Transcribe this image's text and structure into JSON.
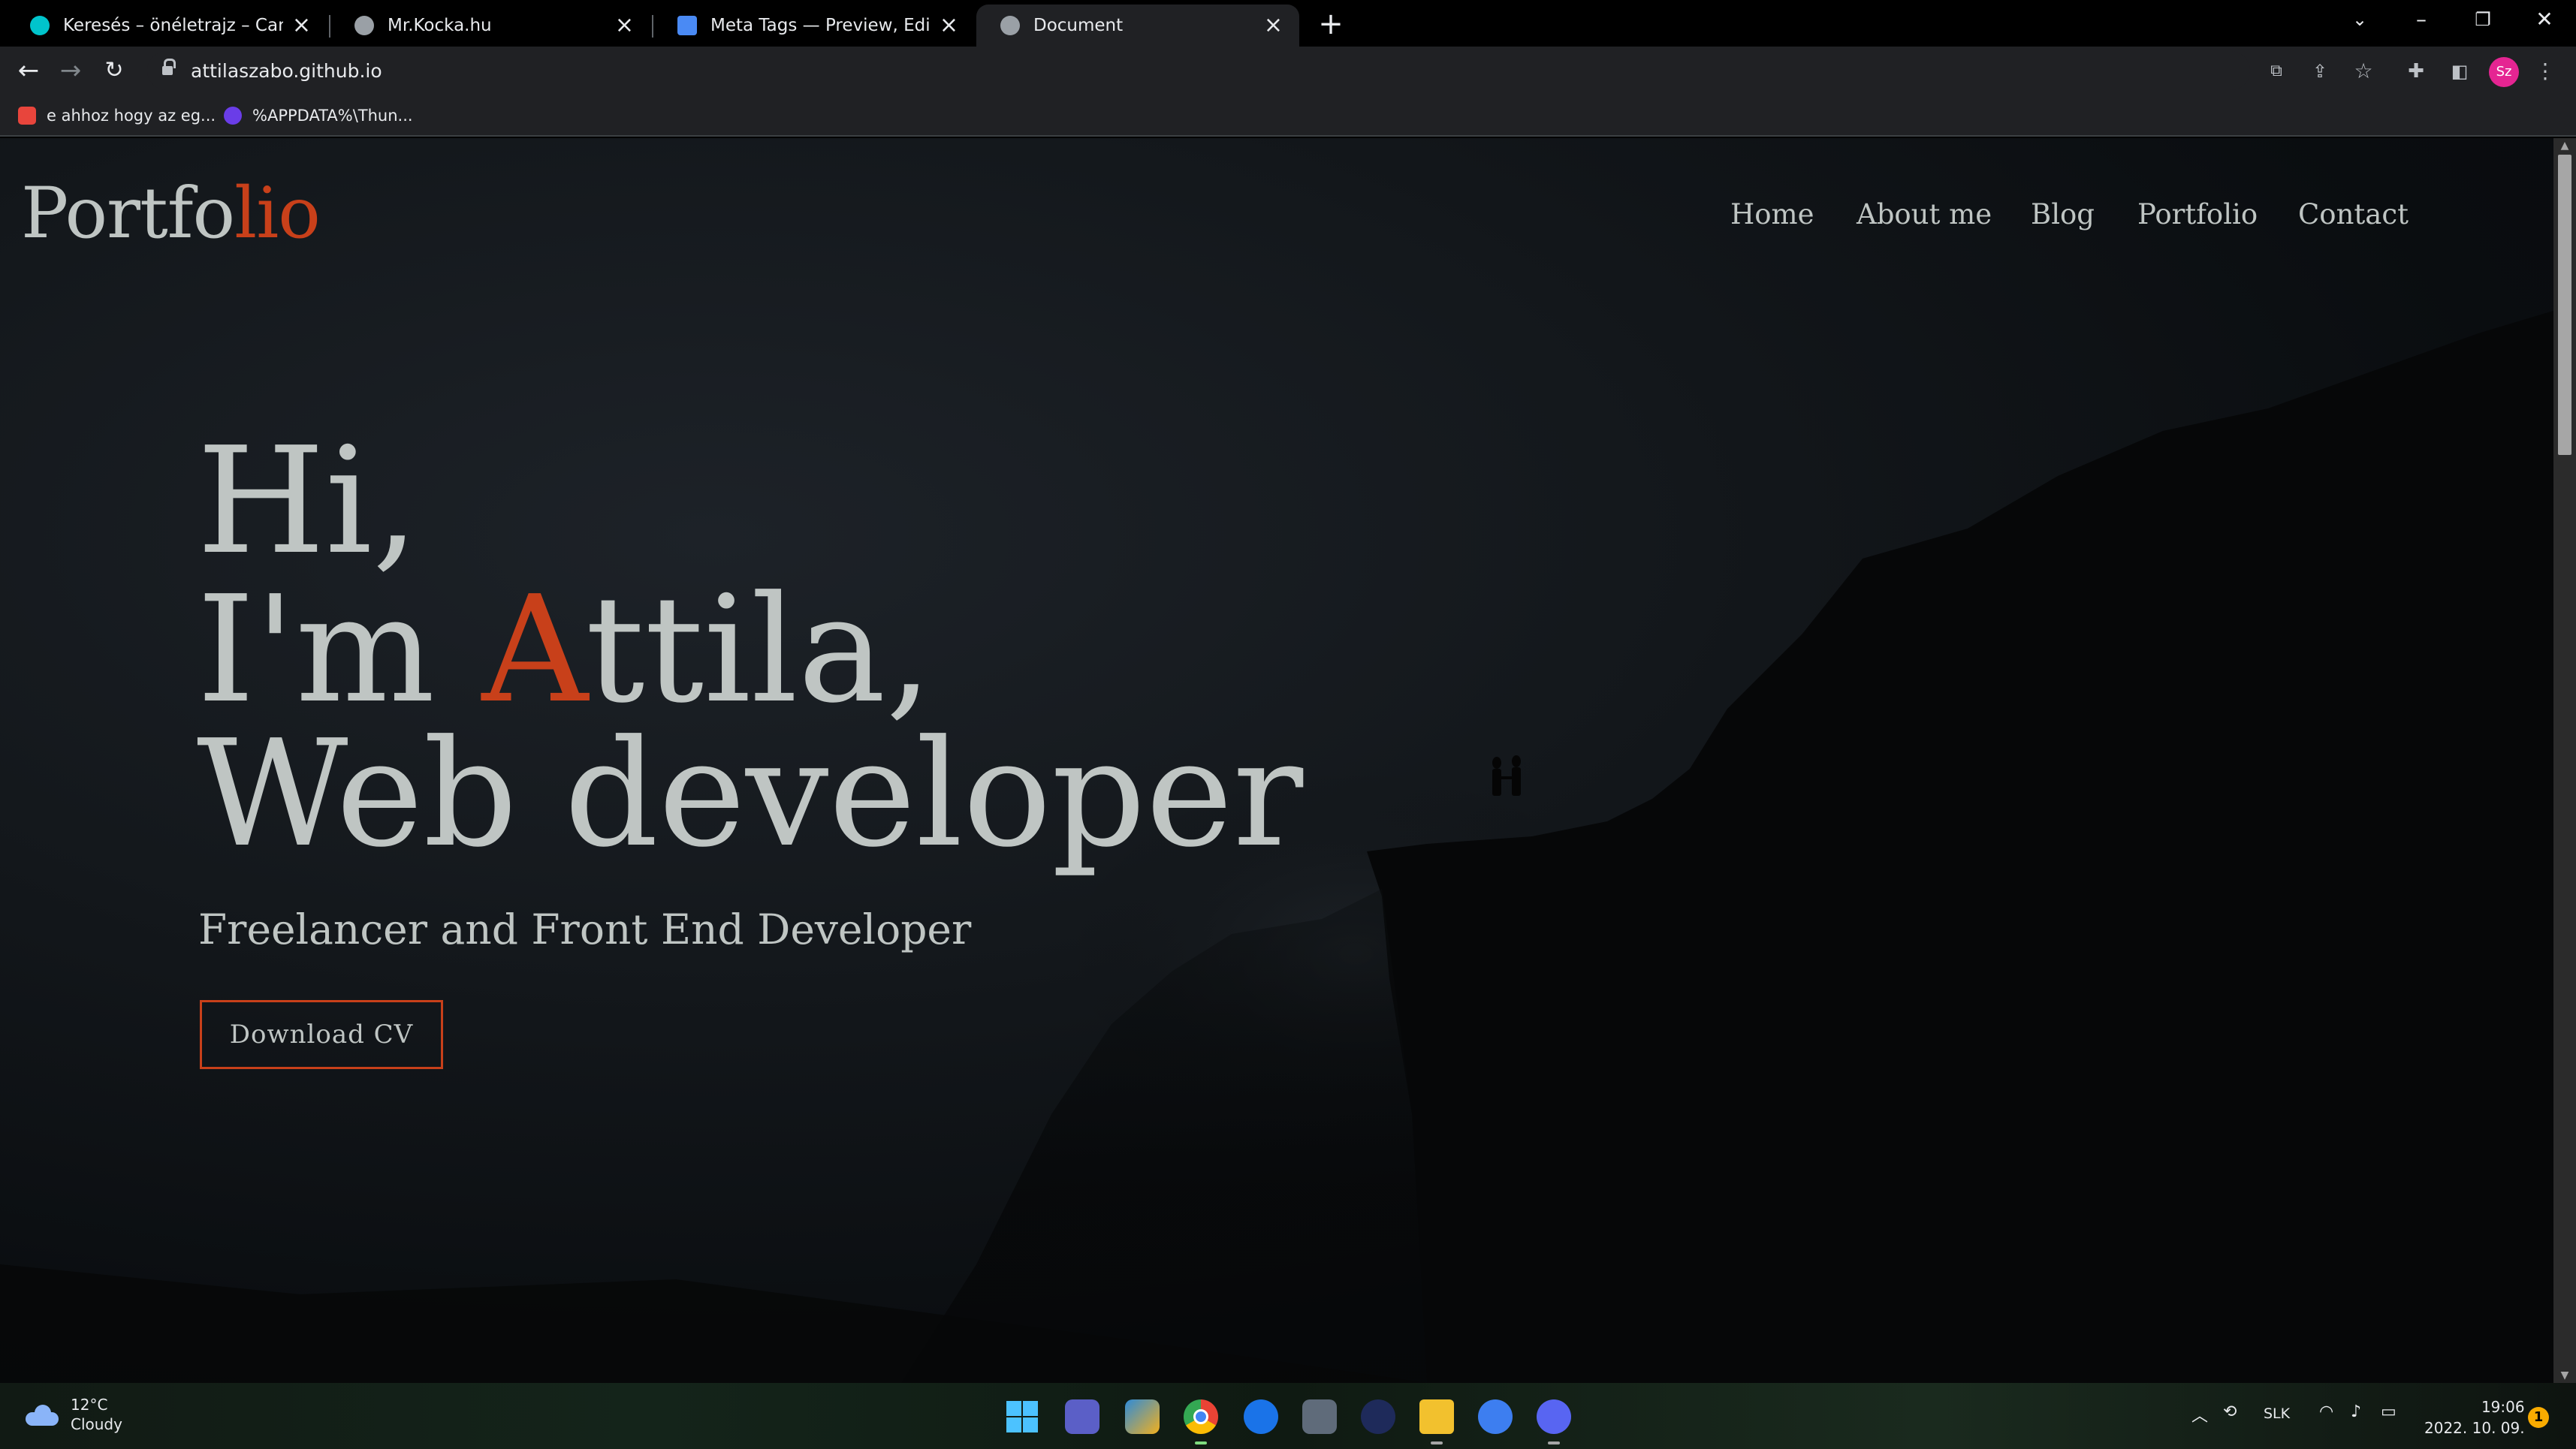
{
  "browser": {
    "tabs": [
      {
        "title": "Keresés – önéletrajz – Canva",
        "favicon_color": "#00c4cc"
      },
      {
        "title": "Mr.Kocka.hu",
        "favicon_color": "#9aa0a6"
      },
      {
        "title": "Meta Tags — Preview, Edit and G",
        "favicon_color": "#4a8af4"
      },
      {
        "title": "Document",
        "favicon_color": "#9aa0a6"
      }
    ],
    "new_tab": "+",
    "url": "attilaszabo.github.io",
    "profile_initials": "Sz",
    "bookmarks": [
      {
        "label": "e ahhoz hogy az eg...",
        "color": "#e8453c"
      },
      {
        "label": "%APPDATA%\\Thun...",
        "color": "#6a3de8"
      }
    ]
  },
  "page": {
    "logo": {
      "main": "Portfo",
      "accent": "lio"
    },
    "nav": [
      "Home",
      "About me",
      "Blog",
      "Portfolio",
      "Contact"
    ],
    "hero": {
      "line1": "Hi,",
      "line2_before": "I'm ",
      "line2_accent": "A",
      "line2_after": "ttila,",
      "line3": "Web developer"
    },
    "subtitle": "Freelancer and Front End Developer",
    "cta": "Download CV",
    "accent_color": "#c8401a",
    "text_color": "#bfc5c3"
  },
  "taskbar": {
    "weather_temp": "12°C",
    "weather_desc": "Cloudy",
    "apps": [
      "start-icon",
      "teams-icon",
      "photos-icon",
      "chrome-icon",
      "mail-icon",
      "calculator-icon",
      "terminal-icon",
      "file-explorer-icon",
      "settings-icon",
      "discord-icon"
    ],
    "language": "SLK",
    "time": "19:06",
    "date": "2022. 10. 09.",
    "notifications": "1"
  }
}
